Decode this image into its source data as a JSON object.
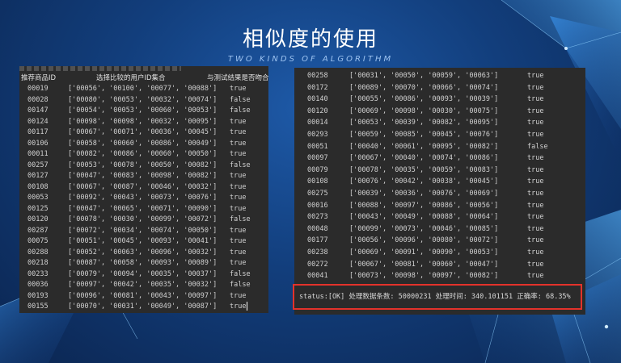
{
  "slide": {
    "title": "相似度的使用",
    "subtitle": "TWO KINDS OF ALGORITHM"
  },
  "left_panel": {
    "headers": {
      "id": "推荐商品ID",
      "ids": "选择比较的用户ID集合",
      "result": "与测试结果是否吻合"
    },
    "rows": [
      {
        "id": "00019",
        "ids": "['00056', '00100', '00077', '00088']",
        "result": "true"
      },
      {
        "id": "00028",
        "ids": "['00080', '00053', '00032', '00074']",
        "result": "false"
      },
      {
        "id": "00147",
        "ids": "['00054', '00053', '00060', '00053']",
        "result": "false"
      },
      {
        "id": "00124",
        "ids": "['00098', '00098', '00032', '00095']",
        "result": "true"
      },
      {
        "id": "00117",
        "ids": "['00067', '00071', '00036', '00045']",
        "result": "true"
      },
      {
        "id": "00106",
        "ids": "['00058', '00060', '00086', '00049']",
        "result": "true"
      },
      {
        "id": "00011",
        "ids": "['00082', '00086', '00060', '00050']",
        "result": "true"
      },
      {
        "id": "00257",
        "ids": "['00053', '00078', '00050', '00082']",
        "result": "false"
      },
      {
        "id": "00127",
        "ids": "['00047', '00083', '00098', '00082']",
        "result": "true"
      },
      {
        "id": "00108",
        "ids": "['00067', '00087', '00046', '00032']",
        "result": "true"
      },
      {
        "id": "00053",
        "ids": "['00092', '00043', '00073', '00076']",
        "result": "true"
      },
      {
        "id": "00125",
        "ids": "['00047', '00065', '00071', '00090']",
        "result": "true"
      },
      {
        "id": "00120",
        "ids": "['00078', '00030', '00099', '00072']",
        "result": "false"
      },
      {
        "id": "00287",
        "ids": "['00072', '00034', '00074', '00050']",
        "result": "true"
      },
      {
        "id": "00075",
        "ids": "['00051', '00045', '00093', '00041']",
        "result": "true"
      },
      {
        "id": "00288",
        "ids": "['00052', '00063', '00096', '00032']",
        "result": "true"
      },
      {
        "id": "00218",
        "ids": "['00087', '00058', '00093', '00089']",
        "result": "true"
      },
      {
        "id": "00233",
        "ids": "['00079', '00094', '00035', '00037']",
        "result": "false"
      },
      {
        "id": "00036",
        "ids": "['00097', '00042', '00035', '00032']",
        "result": "false"
      },
      {
        "id": "00193",
        "ids": "['00096', '00081', '00043', '00097']",
        "result": "true"
      },
      {
        "id": "00155",
        "ids": "['00070', '00031', '00049', '00087']",
        "result": "true"
      }
    ]
  },
  "right_panel": {
    "rows": [
      {
        "id": "00258",
        "ids": "['00031', '00050', '00059', '00063']",
        "result": "true"
      },
      {
        "id": "00172",
        "ids": "['00089', '00070', '00066', '00074']",
        "result": "true"
      },
      {
        "id": "00140",
        "ids": "['00055', '00086', '00093', '00039']",
        "result": "true"
      },
      {
        "id": "00120",
        "ids": "['00069', '00098', '00030', '00075']",
        "result": "true"
      },
      {
        "id": "00014",
        "ids": "['00053', '00039', '00082', '00095']",
        "result": "true"
      },
      {
        "id": "00293",
        "ids": "['00059', '00085', '00045', '00076']",
        "result": "true"
      },
      {
        "id": "00051",
        "ids": "['00040', '00061', '00095', '00082']",
        "result": "false"
      },
      {
        "id": "00097",
        "ids": "['00067', '00040', '00074', '00086']",
        "result": "true"
      },
      {
        "id": "00079",
        "ids": "['00078', '00035', '00059', '00083']",
        "result": "true"
      },
      {
        "id": "00108",
        "ids": "['00076', '00042', '00038', '00045']",
        "result": "true"
      },
      {
        "id": "00275",
        "ids": "['00039', '00036', '00076', '00069']",
        "result": "true"
      },
      {
        "id": "00016",
        "ids": "['00088', '00097', '00086', '00056']",
        "result": "true"
      },
      {
        "id": "00273",
        "ids": "['00043', '00049', '00088', '00064']",
        "result": "true"
      },
      {
        "id": "00048",
        "ids": "['00099', '00073', '00046', '00085']",
        "result": "true"
      },
      {
        "id": "00177",
        "ids": "['00056', '00096', '00080', '00072']",
        "result": "true"
      },
      {
        "id": "00238",
        "ids": "['00069', '00091', '00090', '00053']",
        "result": "true"
      },
      {
        "id": "00272",
        "ids": "['00067', '00081', '00060', '00047']",
        "result": "true"
      },
      {
        "id": "00041",
        "ids": "['00073', '00098', '00097', '00082']",
        "result": "true"
      }
    ],
    "status": "status:[OK] 处理数据条数: 50000231 处理时间: 340.101151 正确率: 68.35%"
  },
  "colors": {
    "panel_background": "#2b2b2b",
    "highlight_border": "#e3322b",
    "slide_background": "#123e7c"
  }
}
